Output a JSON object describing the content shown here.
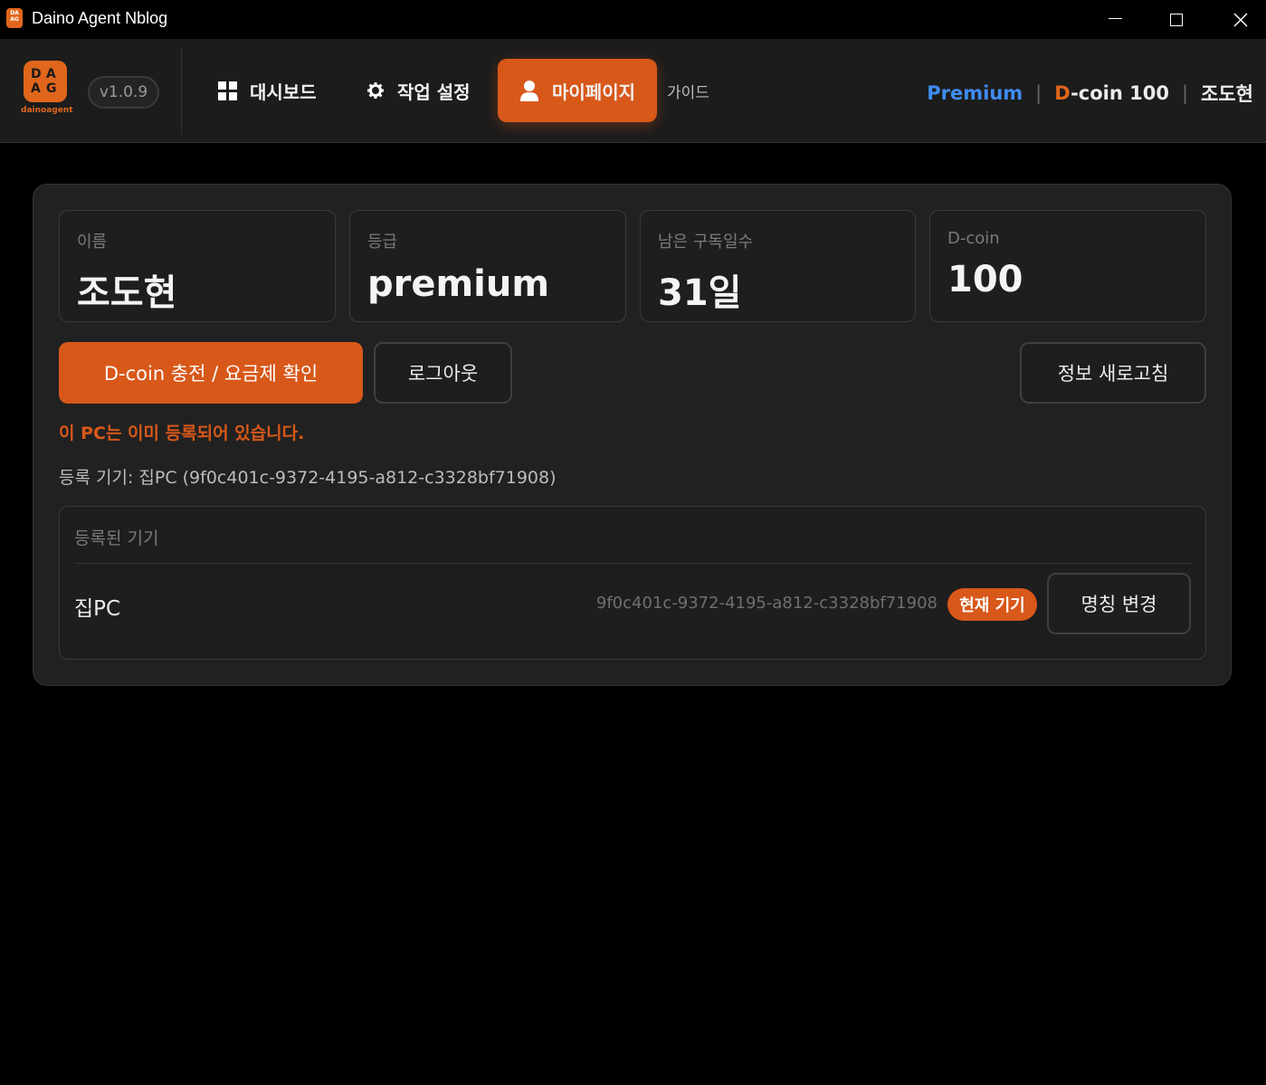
{
  "window": {
    "title": "Daino Agent Nblog",
    "minimize_icon": "minimize-icon",
    "maximize_icon": "maximize-icon",
    "close_icon": "close-icon"
  },
  "header": {
    "logo_letters": [
      "D",
      "A",
      "A",
      "G"
    ],
    "logo_text": "dainoagent",
    "version": "v1.0.9",
    "nav": {
      "dashboard": "대시보드",
      "settings": "작업 설정",
      "mypage": "마이페이지",
      "guide": "가이드"
    },
    "status": {
      "plan": "Premium",
      "coin_prefix": "D",
      "coin_rest": "-coin 100",
      "user": "조도현"
    }
  },
  "profile": {
    "name_label": "이름",
    "name_value": "조도현",
    "grade_label": "등급",
    "grade_value": "premium",
    "days_label": "남은 구독일수",
    "days_value": "31일",
    "coin_label": "D-coin",
    "coin_value": "100"
  },
  "actions": {
    "charge": "D-coin 충전 / 요금제 확인",
    "logout": "로그아웃",
    "refresh": "정보 새로고침"
  },
  "registration": {
    "warning": "이 PC는 이미 등록되어 있습니다.",
    "registered_device": "등록 기기: 집PC (9f0c401c-9372-4195-a812-c3328bf71908)"
  },
  "devices": {
    "title": "등록된 기기",
    "items": [
      {
        "name": "집PC",
        "id": "9f0c401c-9372-4195-a812-c3328bf71908",
        "badge": "현재 기기",
        "rename": "명칭 변경"
      }
    ]
  },
  "colors": {
    "accent": "#d8581a",
    "premium": "#3f8cf0",
    "background": "#000000",
    "panel": "#212121"
  }
}
